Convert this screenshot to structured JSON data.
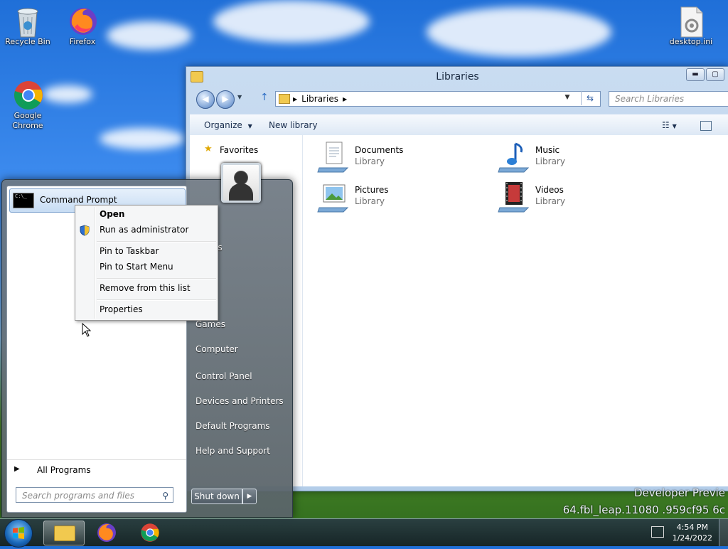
{
  "desktop": {
    "icons": [
      {
        "label": "Recycle Bin"
      },
      {
        "label": "Firefox"
      },
      {
        "label": "Google Chrome"
      },
      {
        "label": "desktop.ini"
      }
    ]
  },
  "explorer": {
    "title": "Libraries",
    "controls": {
      "minimize": "▬",
      "maximize": "▢"
    },
    "address": {
      "crumb": "Libraries"
    },
    "search_placeholder": "Search Libraries",
    "toolbar": {
      "organize": "Organize",
      "new_library": "New library"
    },
    "nav_pane": {
      "favorites": "Favorites"
    },
    "libraries": [
      {
        "name": "Documents",
        "type": "Library"
      },
      {
        "name": "Music",
        "type": "Library"
      },
      {
        "name": "Pictures",
        "type": "Library"
      },
      {
        "name": "Videos",
        "type": "Library"
      }
    ]
  },
  "start_menu": {
    "pinned": {
      "label": "Command Prompt",
      "icon_text": "C:\\_"
    },
    "all_programs": "All Programs",
    "search_placeholder": "Search programs and files",
    "right_links": [
      {
        "label": "Games"
      },
      {
        "label": "Computer"
      },
      {
        "label": "Control Panel"
      },
      {
        "label": "Devices and Printers"
      },
      {
        "label": "Default Programs"
      },
      {
        "label": "Help and Support"
      }
    ],
    "partial_links": [
      {
        "label": "ments"
      },
      {
        "label": "es"
      }
    ],
    "shutdown": "Shut down"
  },
  "context_menu": {
    "items": [
      {
        "label": "Open"
      },
      {
        "label": "Run as administrator"
      },
      {
        "label": "Pin to Taskbar"
      },
      {
        "label": "Pin to Start Menu"
      },
      {
        "label": "Remove from this list"
      },
      {
        "label": "Properties"
      }
    ]
  },
  "watermark": {
    "line1": "Developer Previe",
    "line2": "64.fbl_leap.11080   .959cf95   6c"
  },
  "taskbar": {
    "clock": {
      "time": "4:54 PM",
      "date": "1/24/2022"
    }
  },
  "colors": {
    "accent": "#1766b8",
    "selection": "#c7dcf3"
  }
}
